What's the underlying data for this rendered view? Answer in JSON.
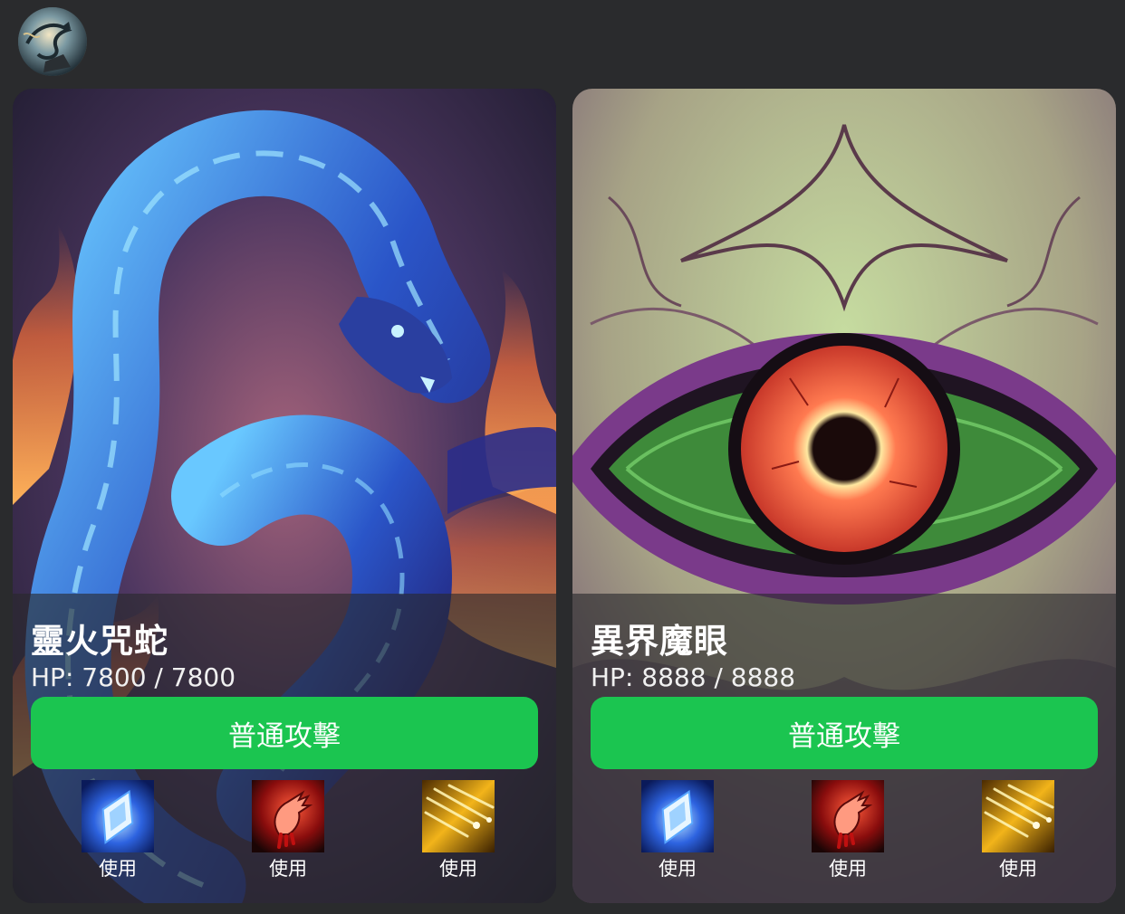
{
  "user": {
    "avatar_icon": "dragon-avatar-icon"
  },
  "cards": [
    {
      "name": "靈火咒蛇",
      "hp_text": "HP: 7800 / 7800",
      "hp_current": 7800,
      "hp_max": 7800,
      "attack_label": "普通攻擊",
      "skills": [
        {
          "icon": "ice-crystal-skill-icon",
          "label": "使用"
        },
        {
          "icon": "blood-hand-skill-icon",
          "label": "使用"
        },
        {
          "icon": "golden-meteor-skill-icon",
          "label": "使用"
        }
      ]
    },
    {
      "name": "異界魔眼",
      "hp_text": "HP: 8888 / 8888",
      "hp_current": 8888,
      "hp_max": 8888,
      "attack_label": "普通攻擊",
      "skills": [
        {
          "icon": "ice-crystal-skill-icon",
          "label": "使用"
        },
        {
          "icon": "blood-hand-skill-icon",
          "label": "使用"
        },
        {
          "icon": "golden-meteor-skill-icon",
          "label": "使用"
        }
      ]
    }
  ],
  "colors": {
    "background": "#2a2b2d",
    "attack_button": "#1bc550",
    "overlay": "rgba(40,40,44,0.62)"
  }
}
